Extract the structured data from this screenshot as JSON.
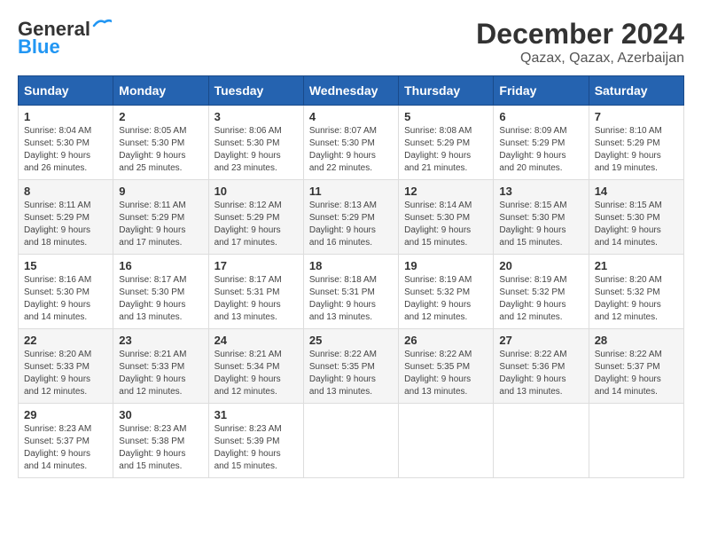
{
  "logo": {
    "line1": "General",
    "line2": "Blue"
  },
  "title": "December 2024",
  "subtitle": "Qazax, Qazax, Azerbaijan",
  "weekdays": [
    "Sunday",
    "Monday",
    "Tuesday",
    "Wednesday",
    "Thursday",
    "Friday",
    "Saturday"
  ],
  "weeks": [
    [
      {
        "day": "1",
        "sunrise": "8:04 AM",
        "sunset": "5:30 PM",
        "daylight": "9 hours and 26 minutes."
      },
      {
        "day": "2",
        "sunrise": "8:05 AM",
        "sunset": "5:30 PM",
        "daylight": "9 hours and 25 minutes."
      },
      {
        "day": "3",
        "sunrise": "8:06 AM",
        "sunset": "5:30 PM",
        "daylight": "9 hours and 23 minutes."
      },
      {
        "day": "4",
        "sunrise": "8:07 AM",
        "sunset": "5:30 PM",
        "daylight": "9 hours and 22 minutes."
      },
      {
        "day": "5",
        "sunrise": "8:08 AM",
        "sunset": "5:29 PM",
        "daylight": "9 hours and 21 minutes."
      },
      {
        "day": "6",
        "sunrise": "8:09 AM",
        "sunset": "5:29 PM",
        "daylight": "9 hours and 20 minutes."
      },
      {
        "day": "7",
        "sunrise": "8:10 AM",
        "sunset": "5:29 PM",
        "daylight": "9 hours and 19 minutes."
      }
    ],
    [
      {
        "day": "8",
        "sunrise": "8:11 AM",
        "sunset": "5:29 PM",
        "daylight": "9 hours and 18 minutes."
      },
      {
        "day": "9",
        "sunrise": "8:11 AM",
        "sunset": "5:29 PM",
        "daylight": "9 hours and 17 minutes."
      },
      {
        "day": "10",
        "sunrise": "8:12 AM",
        "sunset": "5:29 PM",
        "daylight": "9 hours and 17 minutes."
      },
      {
        "day": "11",
        "sunrise": "8:13 AM",
        "sunset": "5:29 PM",
        "daylight": "9 hours and 16 minutes."
      },
      {
        "day": "12",
        "sunrise": "8:14 AM",
        "sunset": "5:30 PM",
        "daylight": "9 hours and 15 minutes."
      },
      {
        "day": "13",
        "sunrise": "8:15 AM",
        "sunset": "5:30 PM",
        "daylight": "9 hours and 15 minutes."
      },
      {
        "day": "14",
        "sunrise": "8:15 AM",
        "sunset": "5:30 PM",
        "daylight": "9 hours and 14 minutes."
      }
    ],
    [
      {
        "day": "15",
        "sunrise": "8:16 AM",
        "sunset": "5:30 PM",
        "daylight": "9 hours and 14 minutes."
      },
      {
        "day": "16",
        "sunrise": "8:17 AM",
        "sunset": "5:30 PM",
        "daylight": "9 hours and 13 minutes."
      },
      {
        "day": "17",
        "sunrise": "8:17 AM",
        "sunset": "5:31 PM",
        "daylight": "9 hours and 13 minutes."
      },
      {
        "day": "18",
        "sunrise": "8:18 AM",
        "sunset": "5:31 PM",
        "daylight": "9 hours and 13 minutes."
      },
      {
        "day": "19",
        "sunrise": "8:19 AM",
        "sunset": "5:32 PM",
        "daylight": "9 hours and 12 minutes."
      },
      {
        "day": "20",
        "sunrise": "8:19 AM",
        "sunset": "5:32 PM",
        "daylight": "9 hours and 12 minutes."
      },
      {
        "day": "21",
        "sunrise": "8:20 AM",
        "sunset": "5:32 PM",
        "daylight": "9 hours and 12 minutes."
      }
    ],
    [
      {
        "day": "22",
        "sunrise": "8:20 AM",
        "sunset": "5:33 PM",
        "daylight": "9 hours and 12 minutes."
      },
      {
        "day": "23",
        "sunrise": "8:21 AM",
        "sunset": "5:33 PM",
        "daylight": "9 hours and 12 minutes."
      },
      {
        "day": "24",
        "sunrise": "8:21 AM",
        "sunset": "5:34 PM",
        "daylight": "9 hours and 12 minutes."
      },
      {
        "day": "25",
        "sunrise": "8:22 AM",
        "sunset": "5:35 PM",
        "daylight": "9 hours and 13 minutes."
      },
      {
        "day": "26",
        "sunrise": "8:22 AM",
        "sunset": "5:35 PM",
        "daylight": "9 hours and 13 minutes."
      },
      {
        "day": "27",
        "sunrise": "8:22 AM",
        "sunset": "5:36 PM",
        "daylight": "9 hours and 13 minutes."
      },
      {
        "day": "28",
        "sunrise": "8:22 AM",
        "sunset": "5:37 PM",
        "daylight": "9 hours and 14 minutes."
      }
    ],
    [
      {
        "day": "29",
        "sunrise": "8:23 AM",
        "sunset": "5:37 PM",
        "daylight": "9 hours and 14 minutes."
      },
      {
        "day": "30",
        "sunrise": "8:23 AM",
        "sunset": "5:38 PM",
        "daylight": "9 hours and 15 minutes."
      },
      {
        "day": "31",
        "sunrise": "8:23 AM",
        "sunset": "5:39 PM",
        "daylight": "9 hours and 15 minutes."
      },
      null,
      null,
      null,
      null
    ]
  ]
}
